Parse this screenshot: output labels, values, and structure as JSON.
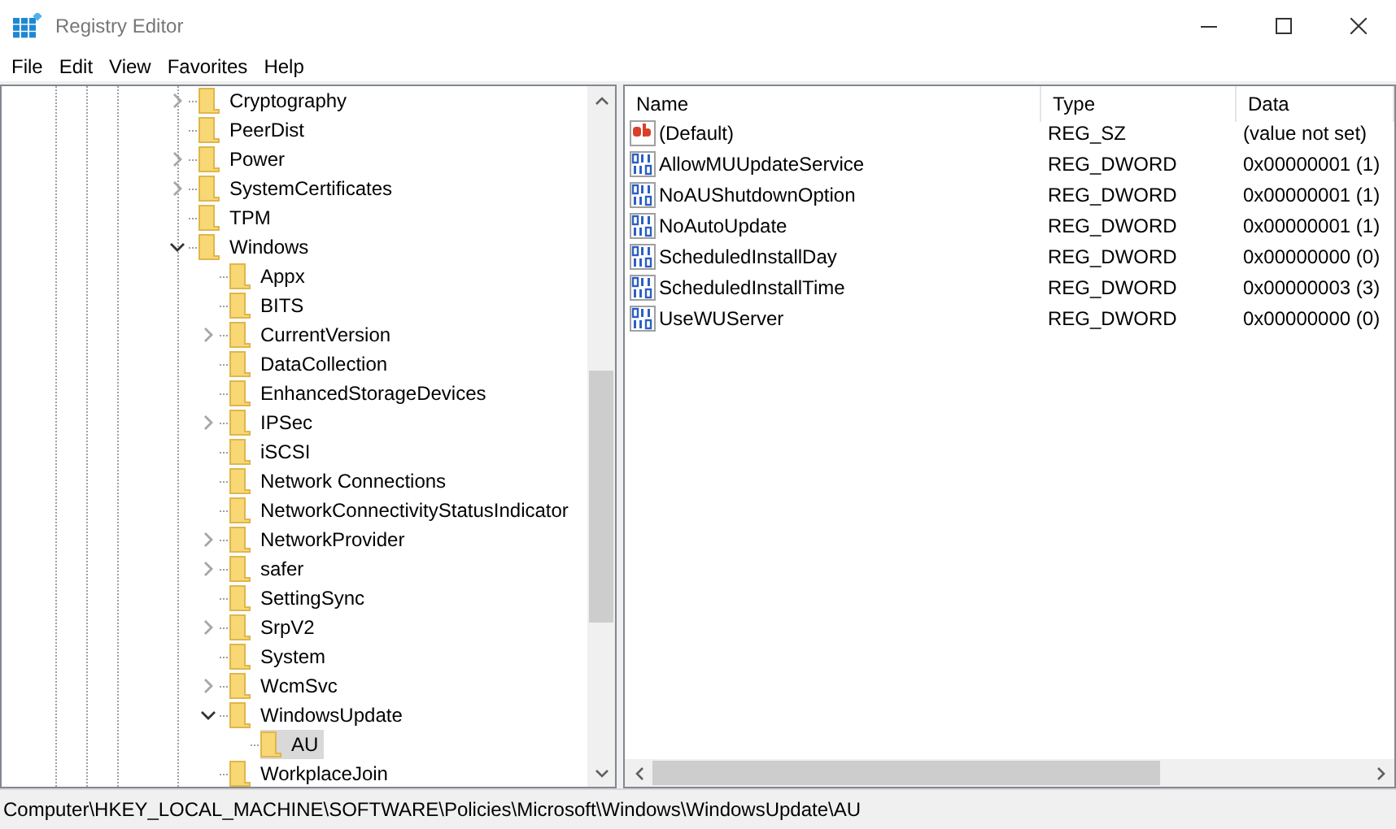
{
  "window": {
    "title": "Registry Editor"
  },
  "menu": [
    "File",
    "Edit",
    "View",
    "Favorites",
    "Help"
  ],
  "tree": [
    {
      "label": "Cryptography",
      "expanded": false,
      "selected": false
    },
    {
      "label": "PeerDist",
      "selected": false
    },
    {
      "label": "Power",
      "expanded": false,
      "selected": false
    },
    {
      "label": "SystemCertificates",
      "expanded": false,
      "selected": false
    },
    {
      "label": "TPM",
      "selected": false
    },
    {
      "label": "Windows",
      "expanded": true,
      "selected": false,
      "children": [
        {
          "label": "Appx",
          "selected": false
        },
        {
          "label": "BITS",
          "selected": false
        },
        {
          "label": "CurrentVersion",
          "expanded": false,
          "selected": false
        },
        {
          "label": "DataCollection",
          "selected": false
        },
        {
          "label": "EnhancedStorageDevices",
          "selected": false
        },
        {
          "label": "IPSec",
          "expanded": false,
          "selected": false
        },
        {
          "label": "iSCSI",
          "selected": false
        },
        {
          "label": "Network Connections",
          "selected": false
        },
        {
          "label": "NetworkConnectivityStatusIndicator",
          "selected": false
        },
        {
          "label": "NetworkProvider",
          "expanded": false,
          "selected": false
        },
        {
          "label": "safer",
          "expanded": false,
          "selected": false
        },
        {
          "label": "SettingSync",
          "selected": false
        },
        {
          "label": "SrpV2",
          "expanded": false,
          "selected": false
        },
        {
          "label": "System",
          "selected": false
        },
        {
          "label": "WcmSvc",
          "expanded": false,
          "selected": false
        },
        {
          "label": "WindowsUpdate",
          "expanded": true,
          "selected": false,
          "children": [
            {
              "label": "AU",
              "selected": true
            }
          ]
        },
        {
          "label": "WorkplaceJoin",
          "selected": false
        }
      ]
    }
  ],
  "table": {
    "columns": [
      "Name",
      "Type",
      "Data"
    ],
    "rows": [
      {
        "kind": "string",
        "name": "(Default)",
        "type": "REG_SZ",
        "data": "(value not set)"
      },
      {
        "kind": "dword",
        "name": "AllowMUUpdateService",
        "type": "REG_DWORD",
        "data": "0x00000001 (1)"
      },
      {
        "kind": "dword",
        "name": "NoAUShutdownOption",
        "type": "REG_DWORD",
        "data": "0x00000001 (1)"
      },
      {
        "kind": "dword",
        "name": "NoAutoUpdate",
        "type": "REG_DWORD",
        "data": "0x00000001 (1)"
      },
      {
        "kind": "dword",
        "name": "ScheduledInstallDay",
        "type": "REG_DWORD",
        "data": "0x00000000 (0)"
      },
      {
        "kind": "dword",
        "name": "ScheduledInstallTime",
        "type": "REG_DWORD",
        "data": "0x00000003 (3)"
      },
      {
        "kind": "dword",
        "name": "UseWUServer",
        "type": "REG_DWORD",
        "data": "0x00000000 (0)"
      }
    ]
  },
  "status_bar": "Computer\\HKEY_LOCAL_MACHINE\\SOFTWARE\\Policies\\Microsoft\\Windows\\WindowsUpdate\\AU"
}
